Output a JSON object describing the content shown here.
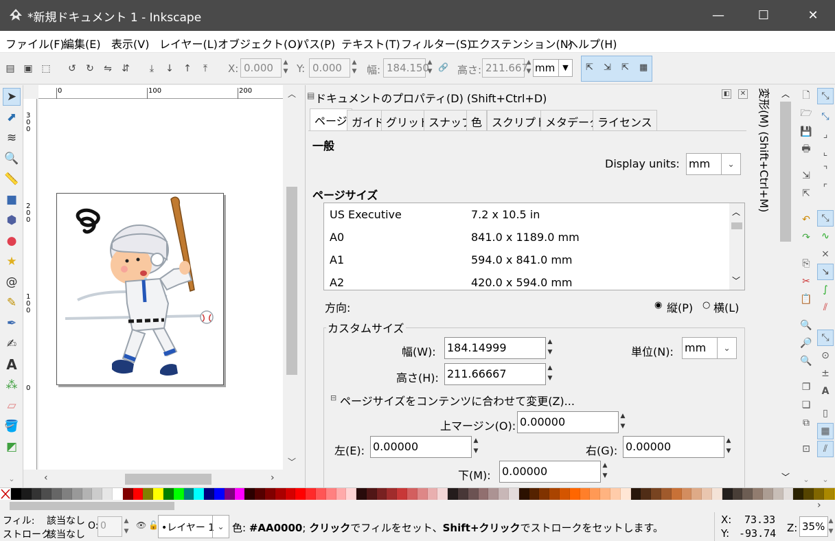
{
  "window": {
    "title": "*新規ドキュメント 1 - Inkscape",
    "minimize": "—",
    "maximize": "☐",
    "close": "✕"
  },
  "menu": [
    "ファイル(F)",
    "編集(E)",
    "表示(V)",
    "レイヤー(L)",
    "オブジェクト(O)",
    "パス(P)",
    "テキスト(T)",
    "フィルター(S)",
    "エクステンション(N)",
    "ヘルプ(H)"
  ],
  "toolctrl": {
    "x_label": "X:",
    "x_value": "0.000",
    "y_label": "Y:",
    "y_value": "0.000",
    "w_label": "幅:",
    "w_value": "184.150",
    "h_label": "高さ:",
    "h_value": "211.667",
    "unit": "mm"
  },
  "ruler_h": [
    "0",
    "100",
    "200"
  ],
  "ruler_v": [
    "3\n0\n0",
    "2\n0\n0",
    "1\n0\n0",
    "0"
  ],
  "panel": {
    "title": "ドキュメントのプロパティ(D) (Shift+Ctrl+D)",
    "tabs": [
      "ページ",
      "ガイド",
      "グリッド",
      "スナップ",
      "色",
      "スクリプト",
      "メタデータ",
      "ライセンス"
    ],
    "general_heading": "一般",
    "display_units_label": "Display units:",
    "display_units_value": "mm",
    "page_size_heading": "ページサイズ",
    "page_sizes": [
      {
        "name": "US Executive",
        "size": "7.2 x 10.5 in"
      },
      {
        "name": "A0",
        "size": "841.0 x 1189.0 mm"
      },
      {
        "name": "A1",
        "size": "594.0 x 841.0 mm"
      },
      {
        "name": "A2",
        "size": "420.0 x 594.0 mm"
      }
    ],
    "orientation_label": "方向:",
    "portrait": "縦(P)",
    "landscape": "横(L)",
    "custom_size_heading": "カスタムサイズ",
    "width_label": "幅(W):",
    "width_value": "184.14999",
    "height_label": "高さ(H):",
    "height_value": "211.66667",
    "unit_label": "単位(N):",
    "unit_value": "mm",
    "resize_label": "ページサイズをコンテンツに合わせて変更(Z)...",
    "top_margin_label": "上マージン(O):",
    "top_margin_value": "0.00000",
    "left_label": "左(E):",
    "left_value": "0.00000",
    "right_label": "右(G):",
    "right_value": "0.00000",
    "bottom_label": "下(M):",
    "bottom_value": "0.00000"
  },
  "dock_tab": "変形(M) (Shift+Ctrl+M)",
  "palette_colors": [
    "#000000",
    "#1a1a1a",
    "#333333",
    "#4d4d4d",
    "#666666",
    "#808080",
    "#999999",
    "#b3b3b3",
    "#cccccc",
    "#e6e6e6",
    "#ffffff",
    "#800000",
    "#ff0000",
    "#808000",
    "#ffff00",
    "#008000",
    "#00ff00",
    "#008080",
    "#00ffff",
    "#000080",
    "#0000ff",
    "#800080",
    "#ff00ff",
    "#2b0000",
    "#550000",
    "#800000",
    "#aa0000",
    "#d40000",
    "#ff0000",
    "#ff2a2a",
    "#ff5555",
    "#ff8080",
    "#ffaaaa",
    "#ffd5d5",
    "#280b0b",
    "#501616",
    "#782121",
    "#a02c2c",
    "#c83737",
    "#d35f5f",
    "#de8787",
    "#e9afaf",
    "#f4d7d7",
    "#241c1c",
    "#483737",
    "#6c5353",
    "#916f6f",
    "#ac9393",
    "#c8b7b7",
    "#e3dbdb",
    "#2b1100",
    "#552200",
    "#803300",
    "#aa4400",
    "#d45500",
    "#ff6600",
    "#ff7f2a",
    "#ff9955",
    "#ffb380",
    "#ffccaa",
    "#ffe6d5",
    "#28170b",
    "#502d16",
    "#784421",
    "#a05a2c",
    "#c87137",
    "#d38d5f",
    "#deaa87",
    "#e9c6af",
    "#f4e3d7",
    "#241f1c",
    "#483e37",
    "#6c5d53",
    "#917c6f",
    "#ac9d93",
    "#c8beb7",
    "#e3dedb",
    "#2b2200",
    "#554400",
    "#806600",
    "#aa8800",
    "#d4aa00",
    "#ffcc00"
  ],
  "status": {
    "fill_label": "フィル:",
    "fill_value": "該当なし",
    "stroke_label": "ストローク:",
    "stroke_value": "該当なし",
    "opacity_label": "O:",
    "opacity_value": "0",
    "layer": "•レイヤー 1",
    "msg_prefix": "色: ",
    "msg_color": "#AA0000",
    "msg_sep": "; ",
    "msg_click": "クリック",
    "msg_mid": "でフィルをセット、",
    "msg_shift": "Shift+クリック",
    "msg_end": "でストロークをセットします。",
    "x_label": "X:",
    "x_value": "73.33",
    "y_label": "Y:",
    "y_value": "-93.74",
    "zoom_label": "Z:",
    "zoom_value": "35%"
  }
}
